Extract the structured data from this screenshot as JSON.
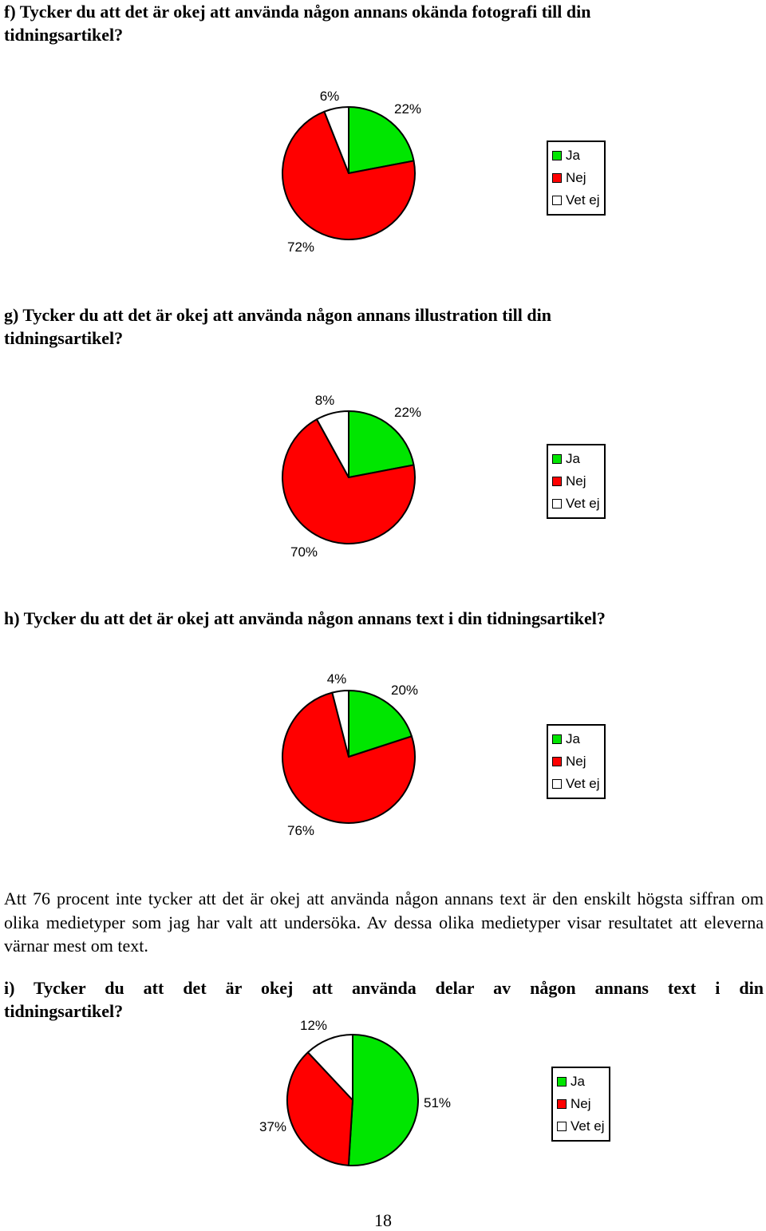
{
  "sections": [
    {
      "question_line1": "f) Tycker du att det är okej att använda någon annans okända fotografi till din",
      "question_line2": "tidningsartikel?"
    },
    {
      "question_line1": "g) Tycker du att det är okej att använda någon annans illustration till din",
      "question_line2": "tidningsartikel?"
    },
    {
      "question_line1": "h) Tycker du att det är okej att använda någon annans text i din tidningsartikel?",
      "question_line2": ""
    },
    {
      "question_line1": "i) Tycker du att det är okej att använda delar av någon annans text i din",
      "question_line2": "tidningsartikel?"
    }
  ],
  "paragraph": "Att 76 procent inte tycker att det är okej att använda någon annans text är den enskilt högsta siffran om olika medietyper som jag har valt att undersöka. Av dessa olika medietyper visar resultatet att eleverna värnar mest om text.",
  "page_number": "18",
  "legend": {
    "items": [
      {
        "label": "Ja",
        "color": "#00e600"
      },
      {
        "label": "Nej",
        "color": "#ff0000"
      },
      {
        "label": "Vet ej",
        "color": "#ffffff"
      }
    ]
  },
  "chart_data": [
    {
      "type": "pie",
      "title": "f) Tycker du att det är okej att använda någon annans okända fotografi till din tidningsartikel?",
      "categories": [
        "Ja",
        "Nej",
        "Vet ej"
      ],
      "values": [
        22,
        72,
        6
      ],
      "labels": [
        "22%",
        "72%",
        "6%"
      ],
      "colors": [
        "#00e600",
        "#ff0000",
        "#ffffff"
      ],
      "legend": "right"
    },
    {
      "type": "pie",
      "title": "g) Tycker du att det är okej att använda någon annans illustration till din tidningsartikel?",
      "categories": [
        "Ja",
        "Nej",
        "Vet ej"
      ],
      "values": [
        22,
        70,
        8
      ],
      "labels": [
        "22%",
        "70%",
        "8%"
      ],
      "colors": [
        "#00e600",
        "#ff0000",
        "#ffffff"
      ],
      "legend": "right"
    },
    {
      "type": "pie",
      "title": "h) Tycker du att det är okej att använda någon annans text i din tidningsartikel?",
      "categories": [
        "Ja",
        "Nej",
        "Vet ej"
      ],
      "values": [
        20,
        76,
        4
      ],
      "labels": [
        "20%",
        "76%",
        "4%"
      ],
      "colors": [
        "#00e600",
        "#ff0000",
        "#ffffff"
      ],
      "legend": "right"
    },
    {
      "type": "pie",
      "title": "i) Tycker du att det är okej att använda delar av någon annans text i din tidningsartikel?",
      "categories": [
        "Ja",
        "Nej",
        "Vet ej"
      ],
      "values": [
        51,
        37,
        12
      ],
      "labels": [
        "51%",
        "37%",
        "12%"
      ],
      "colors": [
        "#00e600",
        "#ff0000",
        "#ffffff"
      ],
      "legend": "right"
    }
  ]
}
